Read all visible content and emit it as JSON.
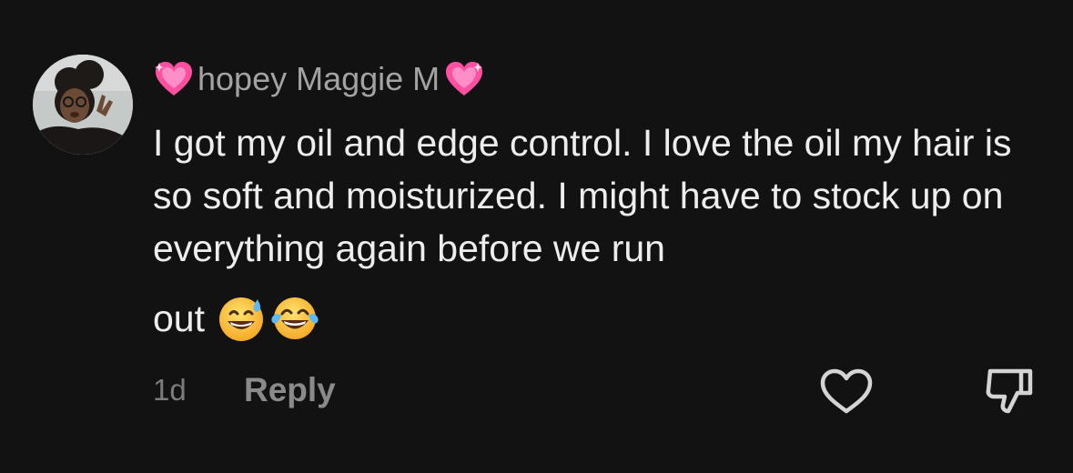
{
  "comment": {
    "avatar_icon": "user-avatar-photo",
    "username_prefix_icon": "sparkling-heart-icon",
    "username": "hopey Maggie M",
    "username_suffix_icon": "sparkling-heart-icon",
    "text": "I got my oil and edge control. I love the oil my hair is so soft and moisturized. I might have to stock up on everything again before we run",
    "text_last_line": "out",
    "emojis": [
      "grinning-face-with-sweat-emoji",
      "face-with-tears-of-joy-emoji"
    ],
    "timestamp": "1d",
    "reply_label": "Reply",
    "like_icon": "heart-outline-icon",
    "dislike_icon": "thumbs-down-icon"
  },
  "colors": {
    "background": "#121212",
    "username": "#a3a3a3",
    "text": "#ededed",
    "timestamp": "#7c7c7c",
    "reply": "#8a8a8a",
    "heart_emoji": "#ff4fa0"
  }
}
